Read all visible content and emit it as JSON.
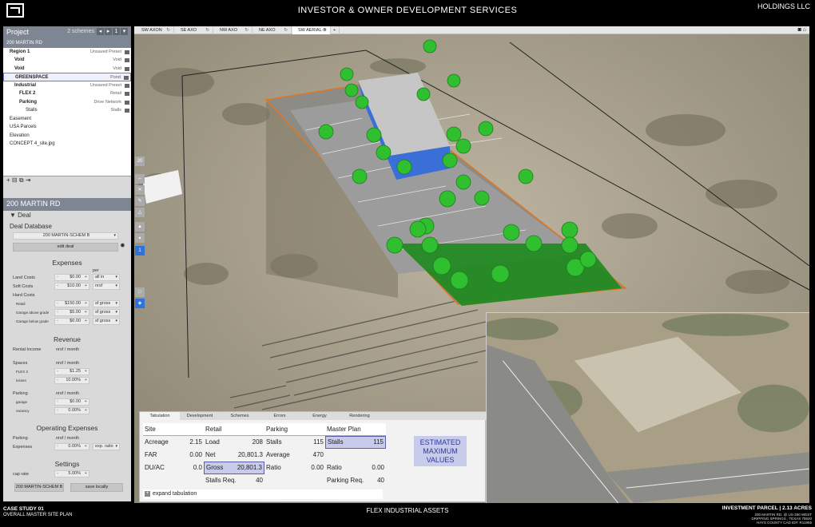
{
  "header": {
    "title": "INVESTOR & OWNER  DEVELOPMENT SERVICES",
    "company": "HOLDINGS LLC"
  },
  "project_panel": {
    "title": "Project",
    "schemes_label": "2 schemes",
    "tree": [
      {
        "label": "200 MARTIN RD",
        "value": "",
        "indent": 0,
        "style": "selected"
      },
      {
        "label": "Region 1",
        "value": "Unsaved Preset",
        "indent": 1,
        "bold": true
      },
      {
        "label": "Void",
        "value": "Void",
        "indent": 2,
        "bold": true
      },
      {
        "label": "Void",
        "value": "Void",
        "indent": 2,
        "bold": true
      },
      {
        "label": "GREENSPACE",
        "value": "Pond",
        "indent": 2,
        "bold": true,
        "style": "highlight"
      },
      {
        "label": "Industrial",
        "value": "Unsaved Preset",
        "indent": 2,
        "bold": true
      },
      {
        "label": "FLEX 2",
        "value": "Retail",
        "indent": 3,
        "bold": true
      },
      {
        "label": "Parking",
        "value": "Drive Network",
        "indent": 3,
        "bold": true
      },
      {
        "label": "Stalls",
        "value": "Stalls",
        "indent": 4
      },
      {
        "label": "Easement",
        "value": "",
        "indent": 1
      },
      {
        "label": "USA Parcels",
        "value": "",
        "indent": 1
      },
      {
        "label": "Elevation",
        "value": "",
        "indent": 1
      },
      {
        "label": "CONCEPT 4_site.jpg",
        "value": "",
        "indent": 1
      }
    ]
  },
  "deal_panel": {
    "title": "200 MARTIN RD",
    "deal_label": "Deal",
    "database_label": "Deal Database",
    "scheme_value": "200 MARTIN-SCHEM B",
    "edit_deal": "edit deal",
    "expenses": {
      "heading": "Expenses",
      "per_label": "per",
      "land_costs": {
        "label": "Land Costs",
        "value": "$0.00",
        "unit": "all in"
      },
      "soft_costs": {
        "label": "Soft Costs",
        "value": "$10.00",
        "unit": "nrsf"
      },
      "hard_costs_label": "Hard Costs",
      "retail": {
        "label": "Retail",
        "value": "$150.00",
        "unit": "sf gross"
      },
      "garage_above": {
        "label": "Garage above grade",
        "value": "$5.00",
        "unit": "sf gross"
      },
      "garage_below": {
        "label": "Garage below grade",
        "value": "$0.00",
        "unit": "sf gross"
      }
    },
    "revenue": {
      "heading": "Revenue",
      "rental_income": {
        "label": "Rental Income",
        "unit": "nrsf / month"
      },
      "spaces": {
        "label": "Spaces",
        "unit": "nrsf / month"
      },
      "flex2": {
        "label": "FLEX 2",
        "value": "$1.25"
      },
      "losses": {
        "label": "losses",
        "value": "10.00%"
      },
      "parking": {
        "label": "Parking",
        "unit": "nrsf / month"
      },
      "garage": {
        "label": "garage",
        "value": "$0.00"
      },
      "vacancy": {
        "label": "vacancy",
        "value": "0.00%"
      }
    },
    "operating": {
      "heading": "Operating Expenses",
      "parking": {
        "label": "Parking",
        "unit": "nrsf / month"
      },
      "expenses": {
        "label": "Expenses",
        "value": "0.00%",
        "unit": "exp. ratio"
      }
    },
    "settings": {
      "heading": "Settings",
      "cap_rate": {
        "label": "cap rate",
        "value": "5.00%"
      },
      "scheme_button": "200 MARTIN-SCHEM B",
      "save_button": "save locally"
    }
  },
  "viewport": {
    "tabs": [
      "SW AXON",
      "SE AXO",
      "NW AXO",
      "NE AXO",
      "SW AERIAL-B"
    ],
    "active_tab": 4,
    "add_tab": "+",
    "side_tool_number": "20",
    "side_tool_layer": "1"
  },
  "tabulation": {
    "tabs": [
      "Tabulation",
      "Development",
      "Schemes",
      "Errors",
      "Energy",
      "Rendering"
    ],
    "headers": {
      "site": "Site",
      "retail": "Retail",
      "parking": "Parking",
      "master": "Master Plan"
    },
    "rows": {
      "acreage_label": "Acreage",
      "acreage": "2.15",
      "far_label": "FAR",
      "far": "0.00",
      "duac_label": "DU/AC",
      "duac": "0.0",
      "load_label": "Load",
      "load": "208",
      "net_label": "Net",
      "net": "20,801.3",
      "gross_label": "Gross",
      "gross": "20,801.3",
      "stalls_label": "Stalls",
      "stalls": "115",
      "average_label": "Average",
      "average": "470",
      "ratio_label": "Ratio",
      "ratio": "0.00",
      "stalls_req_label": "Stalls Req.",
      "stalls_req": "40",
      "mp_stalls_label": "Stalls",
      "mp_stalls": "115",
      "mp_ratio_label": "Ratio",
      "mp_ratio": "0.00",
      "parking_req_label": "Parking Req.",
      "parking_req": "40"
    },
    "estimated": "ESTIMATED MAXIMUM VALUES",
    "expand": "expand tabulation"
  },
  "footer": {
    "case_study": "CASE STUDY 01",
    "plan": "OVERALL MASTER SITE PLAN",
    "center": "FLEX INDUSTRIAL ASSETS",
    "right_title": "INVESTMENT PARCEL  |  2.13 ACRES",
    "address1": "200 MARTIN RD. @  US-290 WEST",
    "address2": "DRIPPING SPRINGS , TEXAS 78620",
    "address3": "HAYS COUNTY CAD ID#: R11955"
  },
  "colors": {
    "building": "#3a6fd8",
    "greenspace": "#1f8a1f",
    "boundary": "#e07820",
    "panel_header": "#7d8692",
    "highlight": "#c8cbe9"
  }
}
